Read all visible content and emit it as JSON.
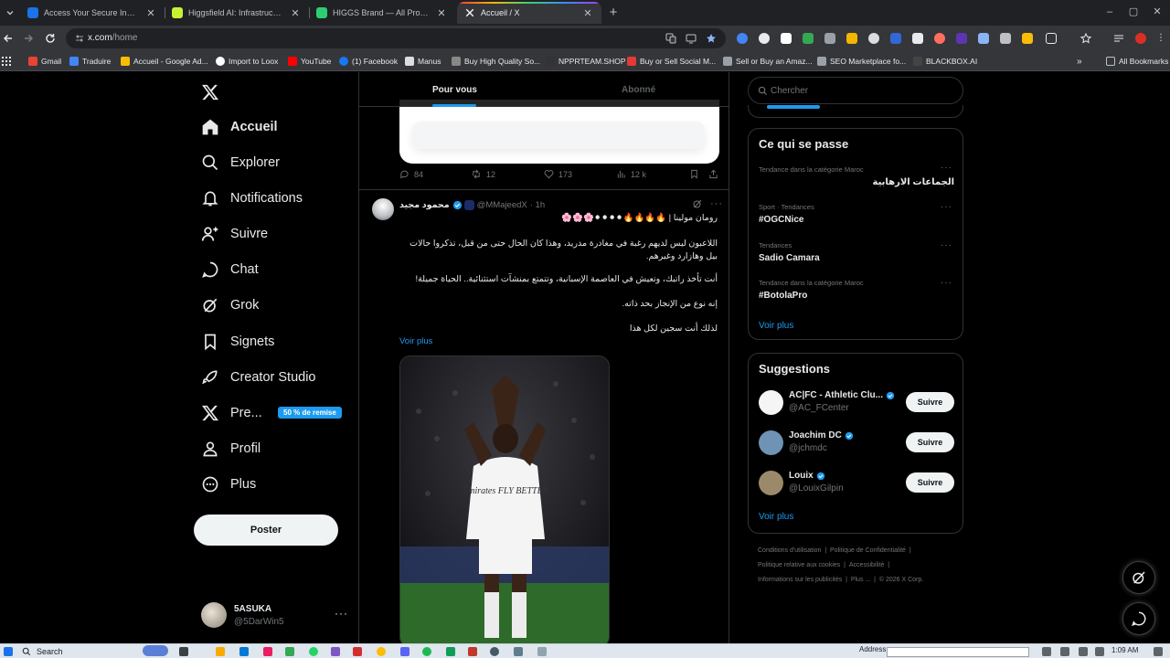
{
  "browser": {
    "tabs": [
      {
        "title": "Access Your Secure Inbox | Ato",
        "favicon_color": "#1a73e8",
        "active": false
      },
      {
        "title": "Higgsfield AI: Infrastructure for",
        "favicon_color": "#c6f432",
        "active": false
      },
      {
        "title": "HIGGS Brand — All Prompts U",
        "favicon_color": "#2ecc71",
        "active": false
      },
      {
        "title": "Accueil / X",
        "favicon_color": "#ffffff",
        "active": true
      }
    ],
    "close_glyph": "✕",
    "new_tab_glyph": "+",
    "window_controls": [
      "–",
      "▢",
      "✕"
    ],
    "url_host": "x.com",
    "url_path": "/home",
    "bookmarks": [
      {
        "label": "Gmail",
        "color": "#ea4335"
      },
      {
        "label": "Traduire",
        "color": "#4285f4"
      },
      {
        "label": "Accueil - Google Ad...",
        "color": "#fbbc04"
      },
      {
        "label": "Import to Loox",
        "color": "#ffffff"
      },
      {
        "label": "YouTube",
        "color": "#ff0000"
      },
      {
        "label": "(1) Facebook",
        "color": "#1877f2"
      },
      {
        "label": "Manus",
        "color": "#dddddd"
      },
      {
        "label": "Buy High Quality So...",
        "color": "#888888"
      },
      {
        "label": "NPPRTEAM.SHOP",
        "color": "#333333"
      },
      {
        "label": "Buy or Sell Social M...",
        "color": "#e53935"
      },
      {
        "label": "Sell or Buy an Amaz...",
        "color": "#9aa0a6"
      },
      {
        "label": "SEO Marketplace fo...",
        "color": "#9aa0a6"
      },
      {
        "label": "BLACKBOX.AI",
        "color": "#444444"
      },
      {
        "label": "All Bookmarks",
        "color": "#bdc1c6"
      }
    ]
  },
  "nav": {
    "items": [
      {
        "label": "Accueil",
        "icon": "home-icon",
        "active": true
      },
      {
        "label": "Explorer",
        "icon": "search-icon"
      },
      {
        "label": "Notifications",
        "icon": "bell-icon"
      },
      {
        "label": "Suivre",
        "icon": "person-add-icon"
      },
      {
        "label": "Chat",
        "icon": "chat-icon"
      },
      {
        "label": "Grok",
        "icon": "grok-icon"
      },
      {
        "label": "Signets",
        "icon": "bookmark-icon"
      },
      {
        "label": "Creator Studio",
        "icon": "rocket-icon"
      },
      {
        "label": "Pre...",
        "icon": "x-logo-icon"
      },
      {
        "label": "Profil",
        "icon": "person-icon"
      },
      {
        "label": "Plus",
        "icon": "more-circle-icon"
      }
    ],
    "premium_badge": "50 % de remise",
    "post_button": "Poster",
    "account": {
      "name": "5ASUKA",
      "handle": "@5DarWin5"
    }
  },
  "timeline": {
    "tabs": [
      "Pour vous",
      "Abonné"
    ],
    "prev_post_stats": {
      "replies": "84",
      "reposts": "12",
      "likes": "173",
      "views": "12 k"
    },
    "tweet": {
      "author": "محمود مجيد",
      "handle": "@MMajeedX",
      "time": "· 1h",
      "lines": [
        "رومان مولينا | 🔥🔥🔥🔥⚫⚫⚫⚫🌸🌸🌸",
        "اللاعبون ليس لديهم رغبة في مغادرة مدريد، وهذا كان الحال حتى من قبل، تذكروا حالات بيل وهازارد وغيرهم.",
        "أنت تأخذ راتبك، وتعيش في العاصمة الإسبانية، وتتمتع بمنشآت استثنائية.. الحياة جميلة!",
        "إنه نوع من الإنجاز بحد ذاته.",
        "لذلك أنت سجين لكل هذا"
      ],
      "show_more": "Voir plus",
      "photo_jersey_text": "Emirates FLY BETTER"
    }
  },
  "sidebar": {
    "search_placeholder": "Chercher",
    "trends_title": "Ce qui se passe",
    "trends": [
      {
        "context": "Tendance dans la catégorie Maroc",
        "topic": "الجماعات الارهابية",
        "rtl": true
      },
      {
        "context": "Sport · Tendances",
        "topic": "#OGCNice",
        "rtl": false
      },
      {
        "context": "Tendances",
        "topic": "Sadio Camara",
        "rtl": false
      },
      {
        "context": "Tendance dans la catégorie Maroc",
        "topic": "#BotolaPro",
        "rtl": false
      }
    ],
    "trends_more": "Voir plus",
    "suggestions_title": "Suggestions",
    "suggestions": [
      {
        "name": "AC|FC - Athletic Clu...",
        "handle": "@AC_FCenter",
        "button": "Suivre",
        "avatar_color": "#f5f5f5"
      },
      {
        "name": "Joachim DC",
        "handle": "@jchmdc",
        "button": "Suivre",
        "avatar_color": "#6f93b5"
      },
      {
        "name": "Louix",
        "handle": "@LouixGilpin",
        "button": "Suivre",
        "avatar_color": "#9b8a6a"
      }
    ],
    "suggestions_more": "Voir plus",
    "footer": [
      [
        "Conditions d'utilisation",
        "|",
        "Politique de Confidentialité",
        "|"
      ],
      [
        "Politique relative aux cookies",
        "|",
        "Accessibilité",
        "|"
      ],
      [
        "Informations sur les publicités",
        "|",
        "Plus ...",
        "|",
        "© 2026 X Corp."
      ]
    ]
  },
  "taskbar": {
    "search_label": "Search",
    "address_label": "Address",
    "clock": "1:09 AM"
  },
  "colors": {
    "accent": "#1d9bf0",
    "background": "#000000",
    "border": "#2f3336",
    "muted": "#71767b"
  }
}
